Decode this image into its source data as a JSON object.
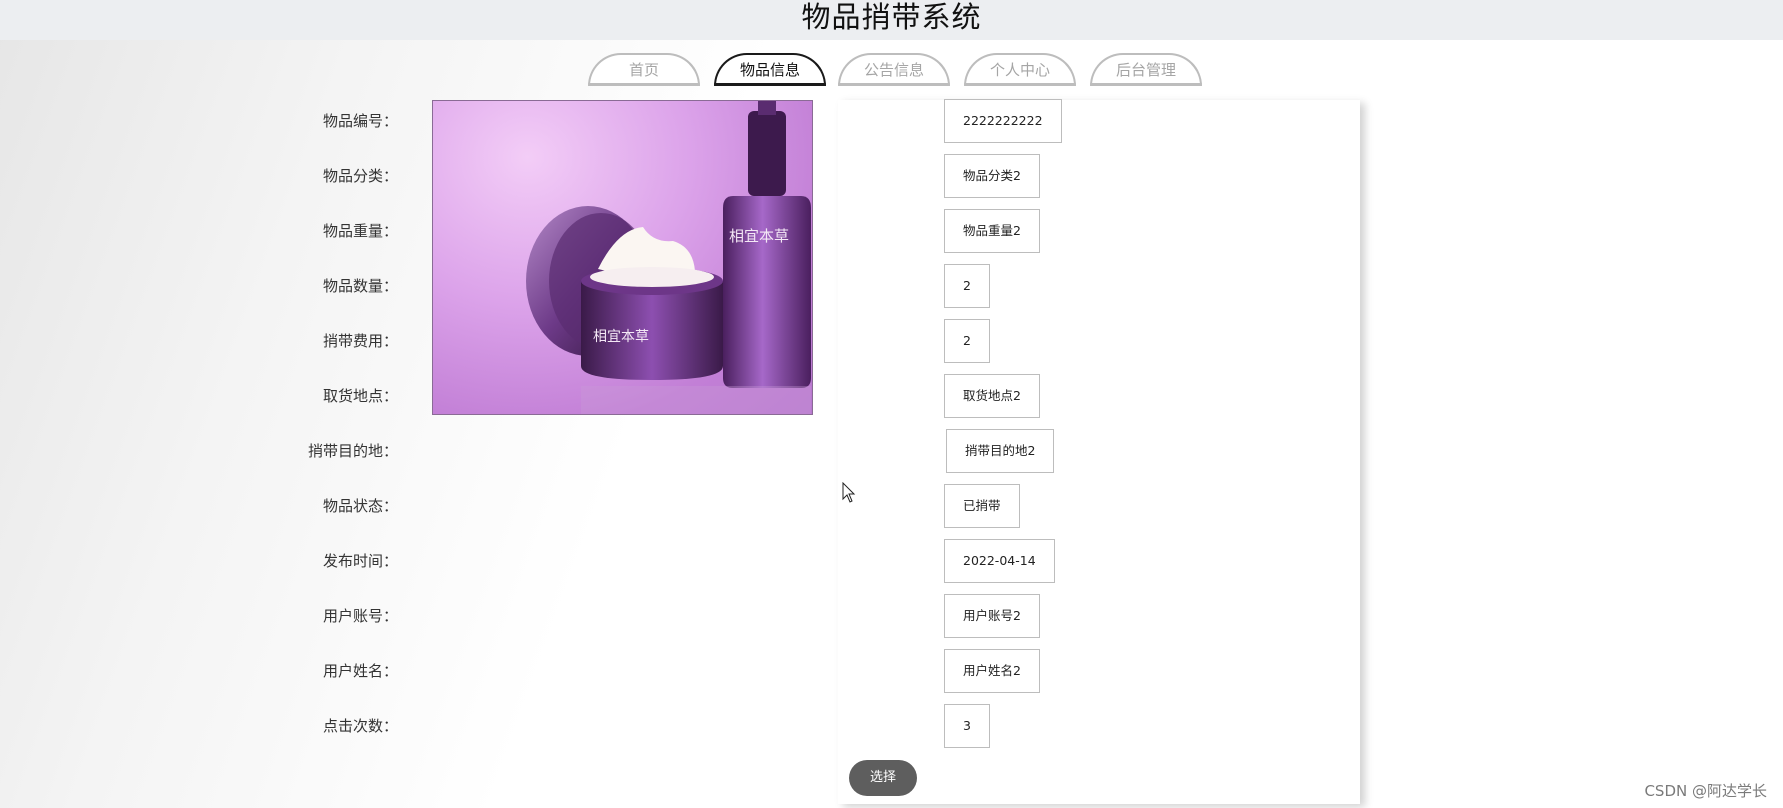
{
  "header": {
    "title": "物品捎带系统"
  },
  "nav": {
    "tabs": [
      {
        "label": "首页"
      },
      {
        "label": "物品信息"
      },
      {
        "label": "公告信息"
      },
      {
        "label": "个人中心"
      },
      {
        "label": "后台管理"
      }
    ],
    "active": "物品信息"
  },
  "product": {
    "image_icon": "cosmetics-product-photo",
    "brand_text": "相宜本草",
    "fields": [
      {
        "label": "物品编号：",
        "value": "2222222222"
      },
      {
        "label": "物品分类：",
        "value": "物品分类2"
      },
      {
        "label": "物品重量：",
        "value": "物品重量2"
      },
      {
        "label": "物品数量：",
        "value": "2"
      },
      {
        "label": "捎带费用：",
        "value": "2"
      },
      {
        "label": "取货地点：",
        "value": "取货地点2"
      },
      {
        "label": "捎带目的地：",
        "value": "捎带目的地2"
      },
      {
        "label": "物品状态：",
        "value": "已捎带"
      },
      {
        "label": "发布时间：",
        "value": "2022-04-14"
      },
      {
        "label": "用户账号：",
        "value": "用户账号2"
      },
      {
        "label": "用户姓名：",
        "value": "用户姓名2"
      },
      {
        "label": "点击次数：",
        "value": "3"
      }
    ],
    "select_label": "选择"
  },
  "watermark": "CSDN @阿达学长",
  "colors": {
    "accent_tab": "#1a1a1a",
    "button": "#5e5e5e",
    "photo_purple": "#c27fd6"
  }
}
